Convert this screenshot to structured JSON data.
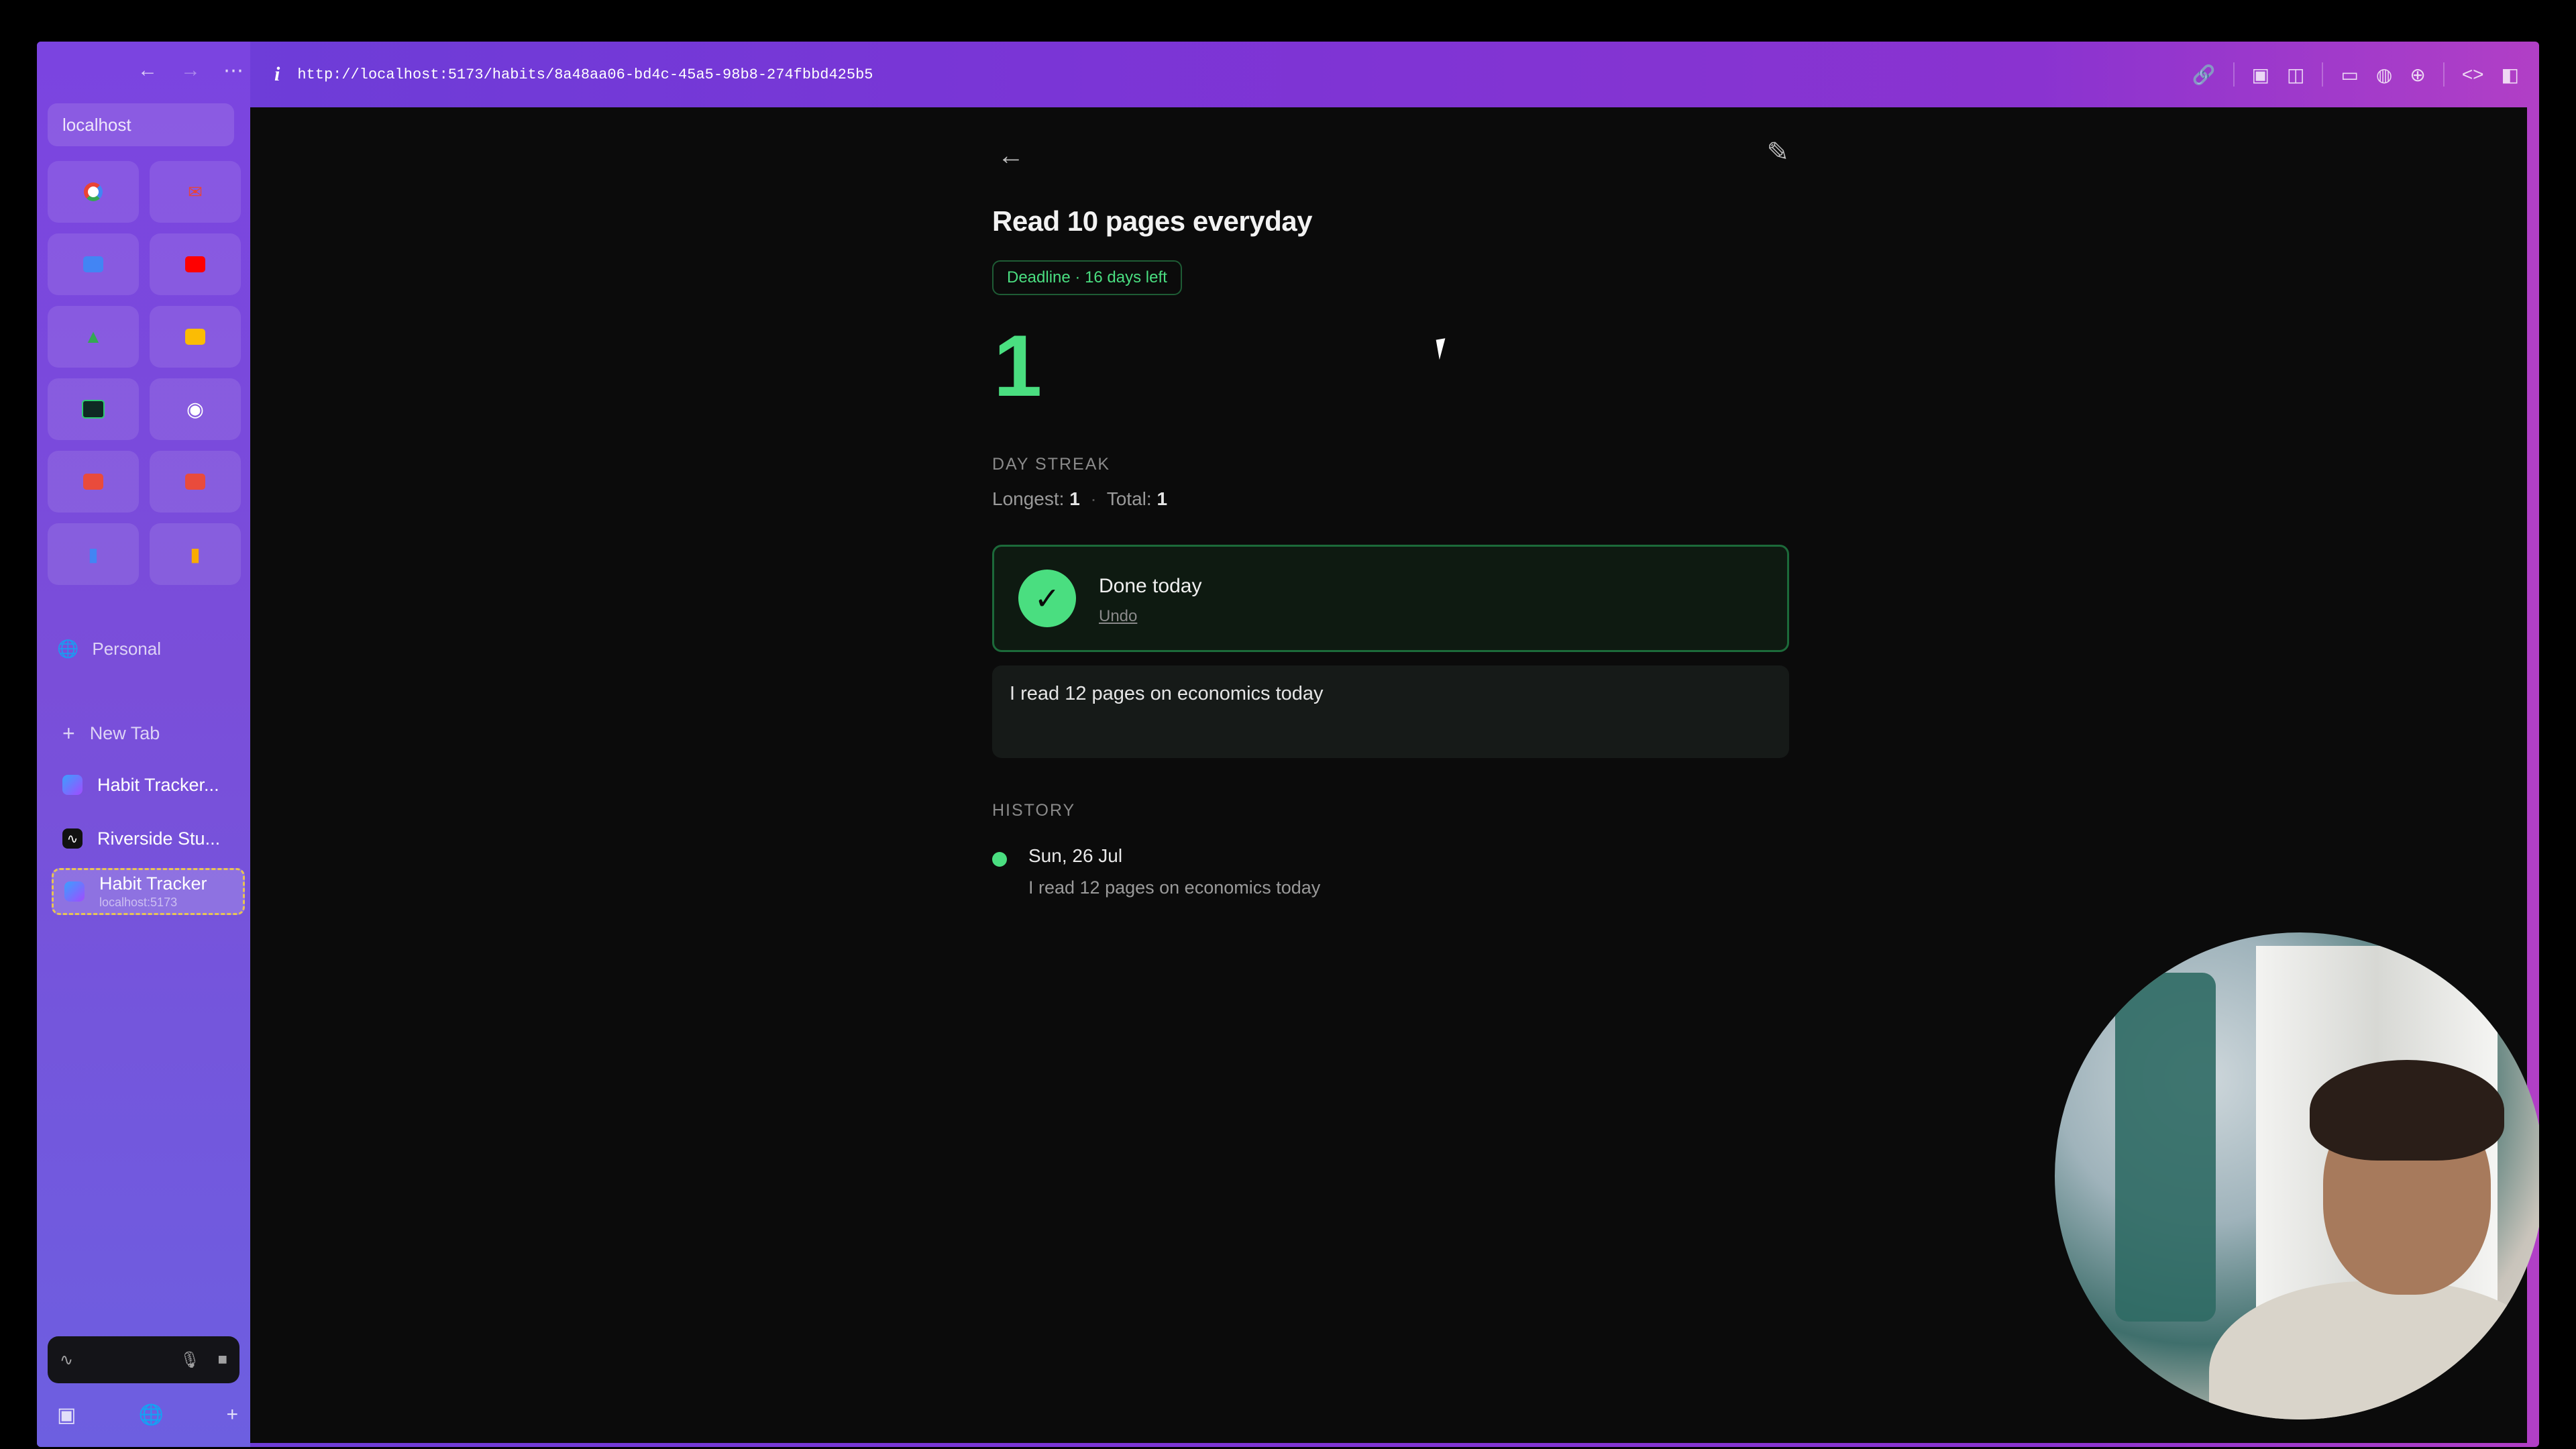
{
  "browser": {
    "sidebar_url": "localhost",
    "address": "http://localhost:5173/habits/8a48aa06-bd4c-45a5-98b8-274fbbd425b5",
    "space_label": "Personal",
    "new_tab_label": "New Tab",
    "tabs": [
      {
        "label": "Habit Tracker..."
      },
      {
        "label": "Riverside Stu..."
      },
      {
        "label": "Habit Tracker",
        "sub": "localhost:5173"
      }
    ]
  },
  "habit": {
    "title": "Read 10 pages everyday",
    "deadline": "Deadline · 16 days left",
    "streak": "1",
    "streak_label": "DAY STREAK",
    "longest_label": "Longest:",
    "longest": "1",
    "total_label": "Total:",
    "total": "1",
    "done_title": "Done today",
    "undo_label": "Undo",
    "note": "I read 12 pages on economics today",
    "history_label": "HISTORY",
    "history": [
      {
        "date": "Sun, 26 Jul",
        "note": "I read 12 pages on economics today"
      }
    ]
  }
}
